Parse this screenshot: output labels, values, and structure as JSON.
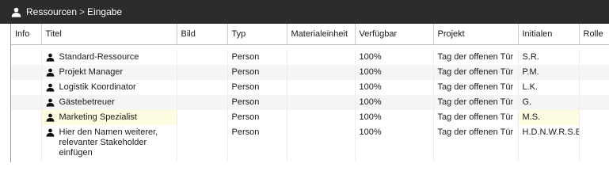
{
  "titlebar": {
    "icon": "person-icon",
    "breadcrumb": [
      "Ressourcen",
      "Eingabe"
    ],
    "separator": ">"
  },
  "columns": [
    "Info",
    "Titel",
    "Bild",
    "Typ",
    "Materialeinheit",
    "Verfügbar",
    "Projekt",
    "Initialen",
    "Rolle"
  ],
  "rows": [
    {
      "info": "",
      "title": "Standard-Ressource",
      "bild": "",
      "typ": "Person",
      "materialeinheit": "",
      "verfuegbar": "100%",
      "projekt": "Tag der offenen Tür",
      "initialen": "S.R.",
      "rolle": ""
    },
    {
      "info": "",
      "title": "Projekt Manager",
      "bild": "",
      "typ": "Person",
      "materialeinheit": "",
      "verfuegbar": "100%",
      "projekt": "Tag der offenen Tür",
      "initialen": "P.M.",
      "rolle": ""
    },
    {
      "info": "",
      "title": "Logistik Koordinator",
      "bild": "",
      "typ": "Person",
      "materialeinheit": "",
      "verfuegbar": "100%",
      "projekt": "Tag der offenen Tür",
      "initialen": "L.K.",
      "rolle": ""
    },
    {
      "info": "",
      "title": "Gästebetreuer",
      "bild": "",
      "typ": "Person",
      "materialeinheit": "",
      "verfuegbar": "100%",
      "projekt": "Tag der offenen Tür",
      "initialen": "G.",
      "rolle": ""
    },
    {
      "info": "",
      "title": "Marketing Spezialist",
      "bild": "",
      "typ": "Person",
      "materialeinheit": "",
      "verfuegbar": "100%",
      "projekt": "Tag der offenen Tür",
      "initialen": "M.S.",
      "rolle": "",
      "highlighted": true
    },
    {
      "info": "",
      "title": "Hier den Namen weiterer, relevanter Stakeholder einfügen",
      "bild": "",
      "typ": "Person",
      "materialeinheit": "",
      "verfuegbar": "100%",
      "projekt": "Tag der offenen Tür",
      "initialen": "H.D.N.W.R.S.E.",
      "rolle": ""
    }
  ],
  "colors": {
    "titlebar_bg": "#2c2c2e",
    "row_alt": "#f5f5f5",
    "highlight": "#fdfbe0"
  }
}
